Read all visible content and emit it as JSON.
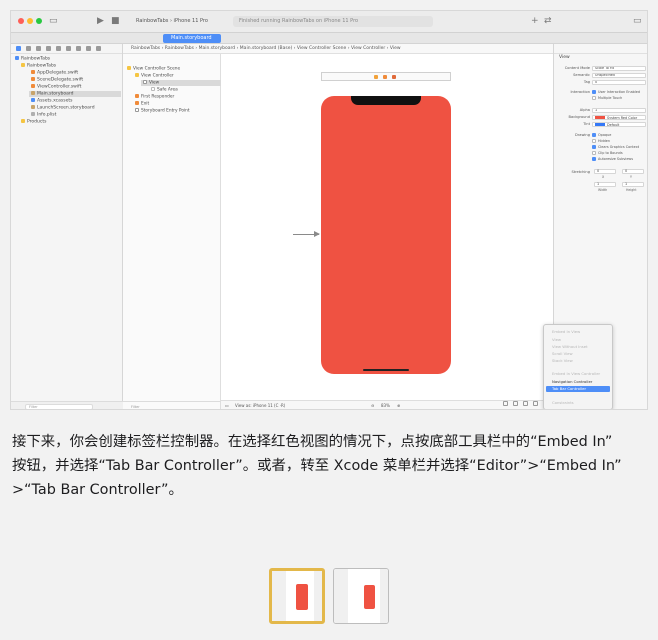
{
  "screenshot": {
    "titlebar": {
      "scheme": "RainbowTabs  ›  iPhone 11 Pro",
      "activity": "Finished running RainbowTabs on iPhone 11 Pro"
    },
    "tab_label": "Main.storyboard",
    "jumpbar": "RainbowTabs  ›  RainbowTabs  ›  Main.storyboard  ›  Main.storyboard (Base)  ›  View Controller Scene  ›  View Controller  ›  View",
    "navigator": {
      "items": [
        {
          "label": "RainbowTabs",
          "kind": "project"
        },
        {
          "label": "RainbowTabs",
          "kind": "folder"
        },
        {
          "label": "AppDelegate.swift",
          "kind": "swift"
        },
        {
          "label": "SceneDelegate.swift",
          "kind": "swift"
        },
        {
          "label": "ViewController.swift",
          "kind": "swift"
        },
        {
          "label": "Main.storyboard",
          "kind": "storyboard",
          "selected": true
        },
        {
          "label": "Assets.xcassets",
          "kind": "assets"
        },
        {
          "label": "LaunchScreen.storyboard",
          "kind": "storyboard"
        },
        {
          "label": "Info.plist",
          "kind": "plist"
        },
        {
          "label": "Products",
          "kind": "folder"
        }
      ],
      "filter_placeholder": "Filter"
    },
    "outline": {
      "items": [
        {
          "label": "View Controller Scene",
          "indent": 0
        },
        {
          "label": "View Controller",
          "indent": 1
        },
        {
          "label": "View",
          "indent": 2,
          "selected": true
        },
        {
          "label": "Safe Area",
          "indent": 3
        },
        {
          "label": "First Responder",
          "indent": 1
        },
        {
          "label": "Exit",
          "indent": 1
        },
        {
          "label": "Storyboard Entry Point",
          "indent": 1
        }
      ],
      "filter_placeholder": "Filter"
    },
    "canvas": {
      "view_color": "#ef5242",
      "bottom_bar": {
        "view_as": "View as: iPhone 11 (C ·R)",
        "zoom": "83%"
      }
    },
    "inspector": {
      "header": "View",
      "rows": [
        {
          "label": "Content Mode",
          "value": "Scale To Fill"
        },
        {
          "label": "Semantic",
          "value": "Unspecified"
        },
        {
          "label": "Tag",
          "value": "0"
        }
      ],
      "interaction": {
        "label": "Interaction",
        "options": [
          "User Interaction Enabled",
          "Multiple Touch"
        ]
      },
      "alpha": {
        "label": "Alpha",
        "value": "1"
      },
      "background": {
        "label": "Background",
        "value": "System Red Color"
      },
      "tint": {
        "label": "Tint",
        "value": "Default"
      },
      "drawing": {
        "label": "Drawing",
        "options": [
          "Opaque",
          "Hidden",
          "Clears Graphics Context",
          "Clip to Bounds",
          "Autoresize Subviews"
        ]
      },
      "stretching": {
        "label": "Stretching",
        "x": "0",
        "y": "0",
        "w": "1",
        "h": "1",
        "sub_x": "X",
        "sub_y": "Y",
        "sub_w": "Width",
        "sub_h": "Height"
      }
    },
    "embed_menu": {
      "header": "Embed In View",
      "items": [
        {
          "label": "View",
          "state": "disabled"
        },
        {
          "label": "View Without Inset",
          "state": "disabled"
        },
        {
          "label": "Scroll View",
          "state": "disabled"
        },
        {
          "label": "Stack View",
          "state": "disabled"
        },
        {
          "label": "Embed In View Controller",
          "state": "disabled"
        },
        {
          "label": "Navigation Controller",
          "state": "enabled"
        },
        {
          "label": "Tab Bar Controller",
          "state": "highlighted"
        },
        {
          "label": "Constraints",
          "state": "disabled"
        }
      ]
    }
  },
  "caption": {
    "line1": "接下来，你会创建标签栏控制器。在选择红色视图的情况下，点按底部工具栏中的“Embed In”",
    "line2": "按钮，并选择“Tab Bar Controller”。或者，转至 Xcode 菜单栏并选择“Editor”>“Embed In”",
    "line3": ">“Tab Bar Controller”。"
  },
  "thumbnails": [
    {
      "name": "step-1",
      "selected": true
    },
    {
      "name": "step-2",
      "selected": false
    }
  ],
  "colors": {
    "accent": "#4e8ef7",
    "view_red": "#ef5242",
    "thumb_selected_border": "#e3b84a"
  }
}
